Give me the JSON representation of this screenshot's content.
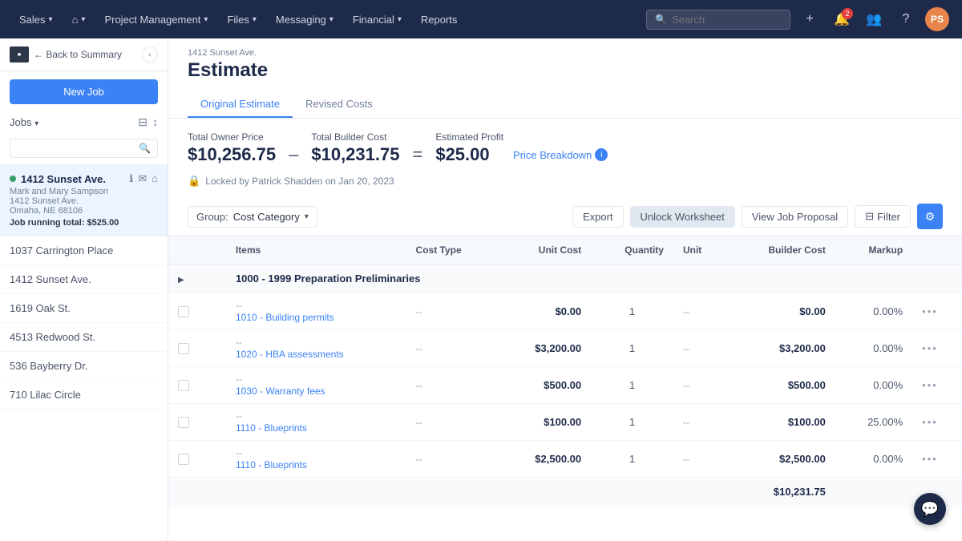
{
  "nav": {
    "items": [
      {
        "label": "Sales",
        "hasChevron": true
      },
      {
        "label": "🏠",
        "hasChevron": true
      },
      {
        "label": "Project Management",
        "hasChevron": true
      },
      {
        "label": "Files",
        "hasChevron": true
      },
      {
        "label": "Messaging",
        "hasChevron": true
      },
      {
        "label": "Financial",
        "hasChevron": true
      },
      {
        "label": "Reports",
        "hasChevron": false
      }
    ],
    "search_placeholder": "Search",
    "notification_count": "2",
    "avatar_initials": "PS"
  },
  "sidebar": {
    "back_label": "← Back to Summary",
    "new_job_label": "New Job",
    "jobs_label": "Jobs",
    "search_placeholder": "",
    "jobs": [
      {
        "name": "1412 Sunset Ave.",
        "contact": "Mark and Mary Sampson",
        "address": "1412 Sunset Ave.",
        "city": "Omaha, NE 68106",
        "total": "Job running total: $525.00",
        "active": true
      },
      {
        "name": "1037 Carrington Place",
        "active": false
      },
      {
        "name": "1412 Sunset Ave.",
        "active": false
      },
      {
        "name": "1619 Oak St.",
        "active": false
      },
      {
        "name": "4513 Redwood St.",
        "active": false
      },
      {
        "name": "536 Bayberry Dr.",
        "active": false
      },
      {
        "name": "710 Lilac Circle",
        "active": false
      }
    ]
  },
  "content": {
    "breadcrumb": "1412 Sunset Ave.",
    "page_title": "Estimate",
    "tabs": [
      {
        "label": "Original Estimate",
        "active": true
      },
      {
        "label": "Revised Costs",
        "active": false
      }
    ],
    "metrics": {
      "owner_price_label": "Total Owner Price",
      "owner_price_value": "$10,256.75",
      "builder_cost_label": "Total Builder Cost",
      "builder_cost_value": "$10,231.75",
      "profit_label": "Estimated Profit",
      "profit_value": "$25.00",
      "price_breakdown_label": "Price Breakdown"
    },
    "lock_text": "Locked by Patrick Shadden on Jan 20, 2023",
    "toolbar": {
      "group_label": "Group:",
      "group_value": "Cost Category",
      "export_label": "Export",
      "unlock_label": "Unlock Worksheet",
      "proposal_label": "View Job Proposal",
      "filter_label": "Filter"
    },
    "table": {
      "columns": [
        "",
        "",
        "Items",
        "Cost Type",
        "Unit Cost",
        "Quantity",
        "Unit",
        "Builder Cost",
        "Markup"
      ],
      "group_row": "1000 - 1999 Preparation Preliminaries",
      "rows": [
        {
          "id": "row1",
          "dash1": "--",
          "item_code": "1010 - Building permits",
          "cost_type": "--",
          "unit_cost": "$0.00",
          "quantity": "1",
          "unit": "--",
          "builder_cost": "$0.00",
          "markup": "0.00%"
        },
        {
          "id": "row2",
          "dash1": "--",
          "item_code": "1020 - HBA assessments",
          "cost_type": "--",
          "unit_cost": "$3,200.00",
          "quantity": "1",
          "unit": "--",
          "builder_cost": "$3,200.00",
          "markup": "0.00%"
        },
        {
          "id": "row3",
          "dash1": "--",
          "item_code": "1030 - Warranty fees",
          "cost_type": "--",
          "unit_cost": "$500.00",
          "quantity": "1",
          "unit": "--",
          "builder_cost": "$500.00",
          "markup": "0.00%"
        },
        {
          "id": "row4",
          "dash1": "--",
          "item_code": "1110 - Blueprints",
          "cost_type": "--",
          "unit_cost": "$100.00",
          "quantity": "1",
          "unit": "--",
          "builder_cost": "$100.00",
          "markup": "25.00%"
        },
        {
          "id": "row5",
          "dash1": "--",
          "item_code": "1110 - Blueprints",
          "cost_type": "--",
          "unit_cost": "$2,500.00",
          "quantity": "1",
          "unit": "--",
          "builder_cost": "$2,500.00",
          "markup": "0.00%"
        }
      ],
      "total_label": "",
      "total_value": "$10,231.75"
    }
  }
}
